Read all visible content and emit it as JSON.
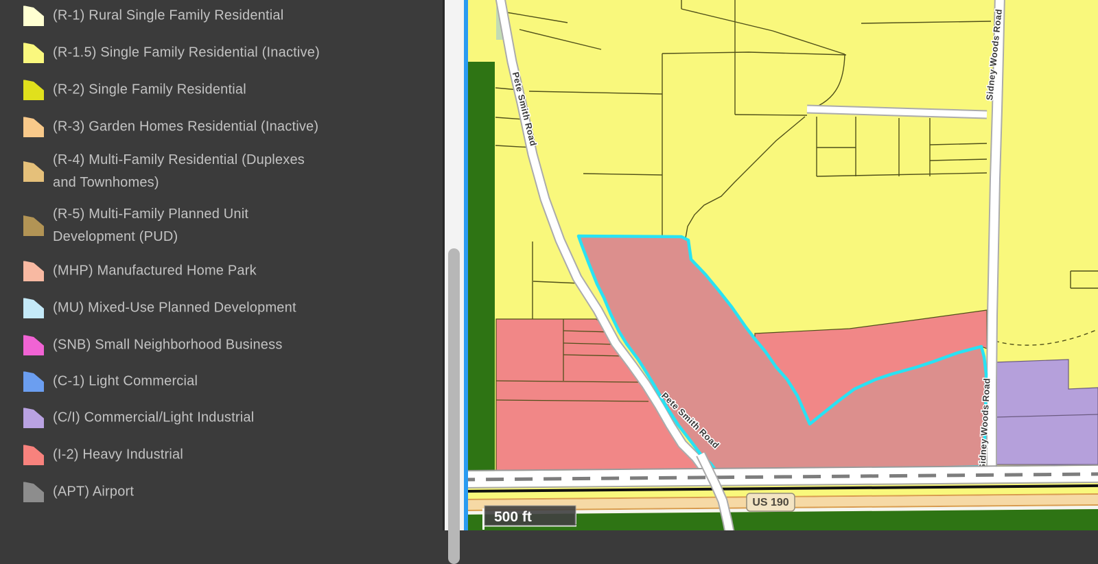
{
  "legend": {
    "items": [
      {
        "label": "(R-1) Rural Single Family Residential",
        "color": "#FFFFD2"
      },
      {
        "label": "(R-1.5) Single Family Residential (Inactive)",
        "color": "#FAF87E"
      },
      {
        "label": "(R-2) Single Family Residential",
        "color": "#E0E01C"
      },
      {
        "label": "(R-3) Garden Homes Residential (Inactive)",
        "color": "#F8C98A"
      },
      {
        "label": "(R-4) Multi-Family Residential (Duplexes\nand Townhomes)",
        "color": "#E5C07A"
      },
      {
        "label": "(R-5) Multi-Family Planned Unit\nDevelopment (PUD)",
        "color": "#B29455"
      },
      {
        "label": "(MHP) Manufactured Home Park",
        "color": "#F8B9A2"
      },
      {
        "label": "(MU) Mixed-Use Planned Development",
        "color": "#C4E9F8"
      },
      {
        "label": "(SNB) Small Neighborhood Business",
        "color": "#F163D4"
      },
      {
        "label": "(C-1) Light Commercial",
        "color": "#6B9EF0"
      },
      {
        "label": "(C/I) Commercial/Light Industrial",
        "color": "#B9A2E2"
      },
      {
        "label": "(I-2) Heavy Industrial",
        "color": "#F8827D"
      },
      {
        "label": "(APT) Airport",
        "color": "#8D8D8D"
      }
    ]
  },
  "map": {
    "labels": {
      "road_pete_smith": "Pete Smith Road",
      "road_sidney_woods": "Sidney Woods Road",
      "highway_shield": "US 190",
      "scale_bar": "500 ft"
    },
    "colors": {
      "yellow": "#F9F87C",
      "parcel_line": "#4f4f19",
      "dark_green": "#2E7414",
      "light_green": "#C2DCB4",
      "industrial_red": "#F18787",
      "selected_fill": "#DC8F8D",
      "selected_outline": "#29E2F3",
      "commercial_purple": "#B5A0DB",
      "purple_line": "#6a5a80",
      "road_fill": "#FFFFFF",
      "road_casing": "#ABABAB",
      "dash_gray": "#7d7d7d",
      "railroad": "#111111",
      "highway_tan": "#F6D9A5",
      "highway_tan_edge": "#D89A50",
      "band_edge": "#9a9a9a",
      "map_border_blue": "#2A9BF1",
      "label_text": "#3a3a3a",
      "shield_fill": "#F3E4C3",
      "shield_border": "#948d7a",
      "shield_text": "#4d483e",
      "scalebar_bg": "#414141",
      "scalebar_text": "#FFFFFF"
    }
  }
}
